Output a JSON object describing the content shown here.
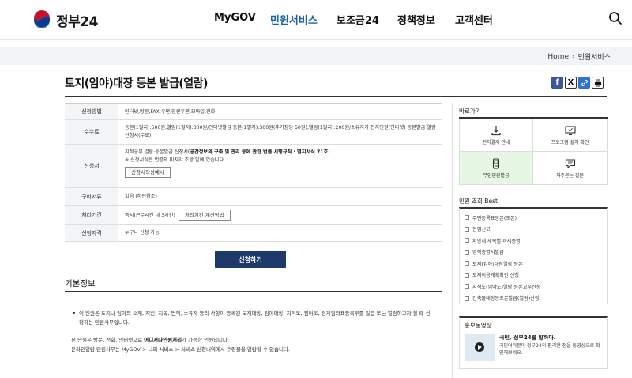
{
  "header": {
    "logo_text": "정부24",
    "nav": [
      "MyGOV",
      "민원서비스",
      "보조금24",
      "정책정보",
      "고객센터"
    ],
    "active_nav": "민원서비스",
    "colors": {
      "active": "#1f5fa8",
      "apply_button": "#1d3a6b"
    }
  },
  "breadcrumb": {
    "home": "Home",
    "current": "민원서비스"
  },
  "page": {
    "title": "토지(임야)대장 등본 발급(열람)"
  },
  "share": {
    "facebook": "f",
    "x": "X",
    "link": "🔗",
    "print": "⎙"
  },
  "info": {
    "rows": [
      {
        "label": "신청방법",
        "value": "인터넷,방문,FAX,우편,민원우편,모바일,전화"
      },
      {
        "label": "수수료",
        "value": "등본(1필지):500원,열람(1필지):300원/인터넷발급 등본(1필지):300원(추가장당 50원),열람(1필지):200원/소유자가 전자민원(인터넷) 등본발급·열람신청시(무료)"
      },
      {
        "label": "신청서",
        "value_prefix": "지적공부 열람·등본발급 신청서(",
        "value_bold": "공간정보의 구축 및 관리 등에 관한 법률 시행규칙 : 별지서식 71호",
        "value_suffix": ")",
        "note": "※ 신청서식은 법령의 미지막 조항 밑에 있습니다.",
        "button": "신청서작성예시"
      },
      {
        "label": "구비서류",
        "value": "없음 (하단참조)"
      },
      {
        "label": "처리기간",
        "value": "즉시(근무시간 내 3시간)",
        "button": "처리기간 계산방법"
      },
      {
        "label": "신청자격",
        "value": "누구나 신청 가능"
      }
    ]
  },
  "apply_button": "신청하기",
  "basic_info": {
    "title": "기본정보",
    "bullet": "이 민원은 토지나 임야의 소재, 지번, 지목, 면적, 소유자 등의 사항이 등록된 토지대장, 임야대장, 지적도, 임야도, 경계점좌표등록부를 발급 또는 열람하고자 할 때 신청하는 민원사무입니다.",
    "p1_prefix": "본 민원은 방문, 전화, 인터넷으로 ",
    "p1_bold": "어디서나민원처리",
    "p1_suffix": "가 가능한 민원입니다.",
    "p2": "온라인열람 민원사무는 MyGOV > 나의 서비스 > 서비스 신청내역에서 수령물을 열람할 수 있습니다."
  },
  "sidebar": {
    "quick_title": "바로가기",
    "quick": [
      {
        "label": "전자결제 안내",
        "icon": "download-icon"
      },
      {
        "label": "프로그램 설치 확인",
        "icon": "monitor-check-icon"
      },
      {
        "label": "무인민원발급",
        "icon": "kiosk-icon"
      },
      {
        "label": "자주묻는 질문",
        "icon": "chat-icon"
      }
    ],
    "best_title": "민원 조회 Best",
    "best": [
      "주민등록표등본(초본)",
      "전입신고",
      "지방세 세목별 과세증명",
      "병적증명서발급",
      "토지(임야)대장열람·등본",
      "토지이용계획확인 신청",
      "지적도(임야도)열람·등본교부신청",
      "건축물대장등초본발급(열람)신청"
    ],
    "promo_title": "홍보동영상",
    "promo_head": "국민, 정부24를 말하다.",
    "promo_text": "국민여러분이 정부24의 편리한 점을 동영상으로 확인해보세요."
  }
}
